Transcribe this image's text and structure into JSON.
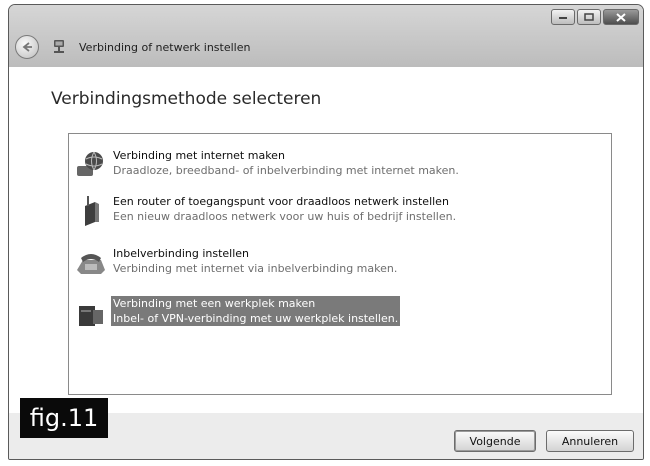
{
  "window": {
    "title": "Verbinding of netwerk instellen"
  },
  "content": {
    "heading": "Verbindingsmethode selecteren",
    "options": [
      {
        "title": "Verbinding met internet maken",
        "description": "Draadloze, breedband- of inbelverbinding met internet maken.",
        "icon": "globe-network-icon",
        "selected": false
      },
      {
        "title": "Een router of toegangspunt voor draadloos netwerk instellen",
        "description": "Een nieuw draadloos netwerk voor uw huis of bedrijf instellen.",
        "icon": "wireless-router-icon",
        "selected": false
      },
      {
        "title": "Inbelverbinding instellen",
        "description": "Verbinding met internet via inbelverbinding maken.",
        "icon": "phone-modem-icon",
        "selected": false
      },
      {
        "title": "Verbinding met een werkplek maken",
        "description": "Inbel- of VPN-verbinding met uw werkplek instellen.",
        "icon": "workplace-icon",
        "selected": true
      }
    ]
  },
  "footer": {
    "next_label": "Volgende",
    "cancel_label": "Annuleren"
  },
  "overlay": {
    "fig_label": "fig.11"
  },
  "colors": {
    "selection": "#7a7a7a",
    "window_chrome": "#c8c8c8",
    "overlay_bg": "#0a0a0a"
  }
}
